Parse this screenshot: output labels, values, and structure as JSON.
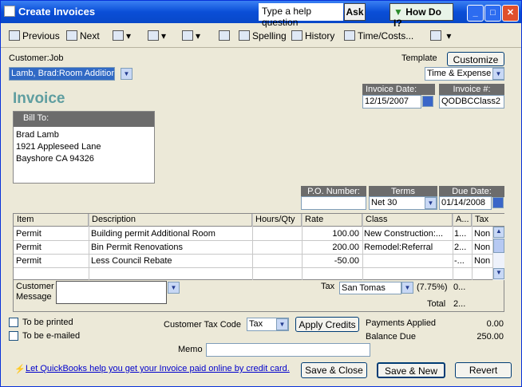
{
  "window": {
    "title": "Create Invoices"
  },
  "help": {
    "box_text": "Type a help question",
    "ask_label": "Ask",
    "how_do_i_label": "How Do I?"
  },
  "toolbar": {
    "previous": "Previous",
    "next": "Next",
    "spelling": "Spelling",
    "history": "History",
    "time_costs": "Time/Costs..."
  },
  "header": {
    "customer_job_label": "Customer:Job",
    "customer_job_value": "Lamb, Brad:Room Addition",
    "template_label": "Template",
    "customize_label": "Customize",
    "template_value": "Time & Expense Inv...",
    "form_title": "Invoice",
    "invoice_date_label": "Invoice Date:",
    "invoice_date": "12/15/2007",
    "invoice_no_label": "Invoice #:",
    "invoice_no": "QODBCClass2"
  },
  "bill_to": {
    "label": "Bill To:",
    "lines": [
      "Brad Lamb",
      "1921 Appleseed Lane",
      "Bayshore CA 94326"
    ]
  },
  "terms": {
    "po_label": "P.O. Number:",
    "po_value": "",
    "terms_label": "Terms",
    "terms_value": "Net 30",
    "due_label": "Due Date:",
    "due_value": "01/14/2008"
  },
  "table": {
    "headers": [
      "Item",
      "Description",
      "Hours/Qty",
      "Rate",
      "Class",
      "A...",
      "Tax"
    ],
    "rows": [
      {
        "item": "Permit",
        "description": "Building permit Additional Room",
        "qty": "",
        "rate": "100.00",
        "class": "New Construction:...",
        "amount": "1...",
        "tax": "Non"
      },
      {
        "item": "Permit",
        "description": "Bin Permit Renovations",
        "qty": "",
        "rate": "200.00",
        "class": "Remodel:Referral",
        "amount": "2...",
        "tax": "Non"
      },
      {
        "item": "Permit",
        "description": "Less Council Rebate",
        "qty": "",
        "rate": "-50.00",
        "class": "",
        "amount": "-...",
        "tax": "Non"
      }
    ]
  },
  "summary": {
    "customer_message_label": "Customer Message",
    "customer_message_label_1": "Customer",
    "customer_message_label_2": "Message",
    "tax_label": "Tax",
    "tax_value": "San Tomas",
    "tax_rate": "(7.75%)",
    "tax_amount": "0...",
    "total_label": "Total",
    "total_value": "2..."
  },
  "footer": {
    "to_be_printed": "To be printed",
    "to_be_emailed": "To be e-mailed",
    "tax_code_label": "Customer Tax Code",
    "tax_code_value": "Tax",
    "apply_credits": "Apply Credits",
    "payments_applied_label": "Payments Applied",
    "payments_applied_value": "0.00",
    "balance_due_label": "Balance Due",
    "balance_due_value": "250.00",
    "memo_label": "Memo",
    "memo_value": "",
    "promo_link": "Let QuickBooks help you get your Invoice paid online by credit card.",
    "save_close": "Save & Close",
    "save_new": "Save & New",
    "revert": "Revert"
  }
}
